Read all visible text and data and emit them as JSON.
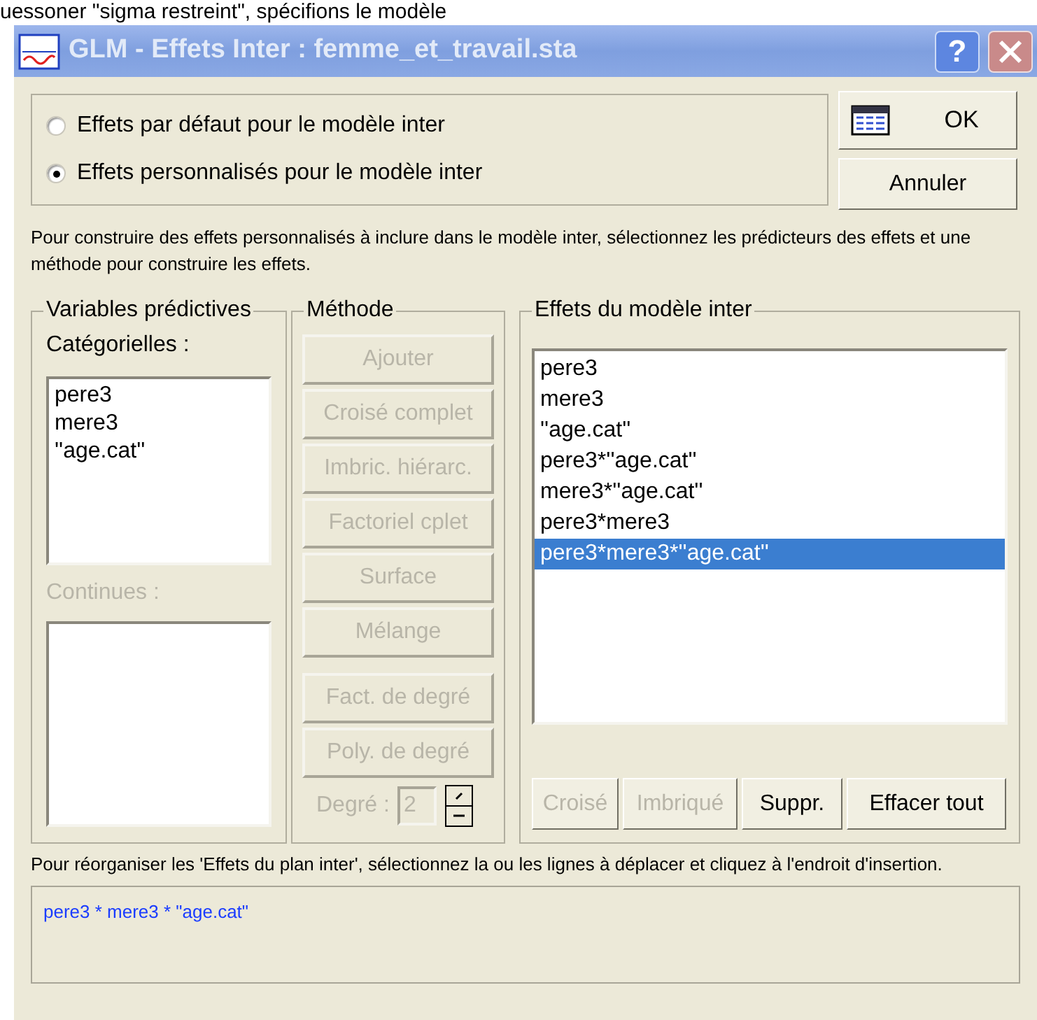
{
  "background_text": "uessoner \"sigma restreint\", spécifions le modèle",
  "window": {
    "title": "GLM - Effets Inter : femme_et_travail.sta",
    "help_button": "?"
  },
  "effects_mode": [
    {
      "label": "Effets par défaut pour le modèle inter",
      "selected": false
    },
    {
      "label": "Effets personnalisés pour le modèle inter",
      "selected": true
    }
  ],
  "ok_button": "OK",
  "cancel_button": "Annuler",
  "instructions": "Pour construire des effets personnalisés à inclure dans le modèle inter, sélectionnez les prédicteurs des effets et une méthode pour construire les effets.",
  "predictors": {
    "title": "Variables prédictives",
    "categorical_label": "Catégorielles :",
    "categorical": [
      "pere3",
      "mere3",
      "''age.cat''"
    ],
    "continuous_label": "Continues :",
    "continuous_disabled": true
  },
  "method": {
    "title": "Méthode",
    "buttons": [
      {
        "label": "Ajouter",
        "disabled": true
      },
      {
        "label": "Croisé complet",
        "disabled": true
      },
      {
        "label": "Imbric. hiérarc.",
        "disabled": true
      },
      {
        "label": "Factoriel cplet",
        "disabled": true
      },
      {
        "label": "Surface",
        "disabled": true
      },
      {
        "label": "Mélange",
        "disabled": true
      },
      {
        "label": "Fact. de degré",
        "disabled": true
      },
      {
        "label": "Poly. de degré",
        "disabled": true
      }
    ],
    "degree_label": "Degré :",
    "degree_value": "2",
    "degree_disabled": true
  },
  "effects": {
    "title": "Effets du modèle inter",
    "items": [
      {
        "label": "pere3",
        "selected": false
      },
      {
        "label": "mere3",
        "selected": false
      },
      {
        "label": "''age.cat''",
        "selected": false
      },
      {
        "label": "pere3*''age.cat''",
        "selected": false
      },
      {
        "label": "mere3*''age.cat''",
        "selected": false
      },
      {
        "label": "pere3*mere3",
        "selected": false
      },
      {
        "label": "pere3*mere3*''age.cat''",
        "selected": true
      }
    ],
    "buttons": [
      {
        "label": "Croisé",
        "disabled": true
      },
      {
        "label": "Imbriqué",
        "disabled": true
      },
      {
        "label": "Suppr.",
        "disabled": false
      },
      {
        "label": "Effacer tout",
        "disabled": false
      }
    ]
  },
  "reorder_hint": "Pour réorganiser les 'Effets du plan inter', sélectionnez la ou les lignes à déplacer et cliquez à l'endroit d'insertion.",
  "formula": "pere3 * mere3 * \"age.cat\""
}
